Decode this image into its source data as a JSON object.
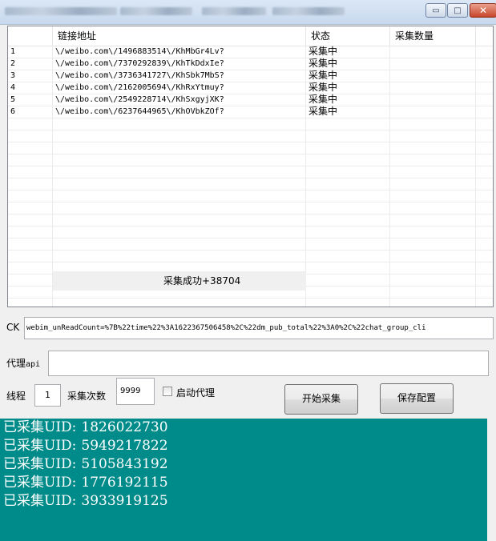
{
  "window": {
    "minimize_glyph": "▭",
    "maximize_glyph": "□",
    "close_glyph": "✕"
  },
  "table": {
    "headers": [
      "链接地址",
      "状态",
      "采集数量"
    ],
    "rows": [
      {
        "index": "1",
        "url": "\\/weibo.com\\/1496883514\\/KhMbGr4Lv?",
        "status": "采集中",
        "count": ""
      },
      {
        "index": "2",
        "url": "\\/weibo.com\\/7370292839\\/KhTkDdxIe?",
        "status": "采集中",
        "count": ""
      },
      {
        "index": "3",
        "url": "\\/weibo.com\\/3736341727\\/KhSbk7MbS?",
        "status": "采集中",
        "count": ""
      },
      {
        "index": "4",
        "url": "\\/weibo.com\\/2162005694\\/KhRxYtmuy?",
        "status": "采集中",
        "count": ""
      },
      {
        "index": "5",
        "url": "\\/weibo.com\\/2549228714\\/KhSxgyjXK?",
        "status": "采集中",
        "count": ""
      },
      {
        "index": "6",
        "url": "\\/weibo.com\\/6237644965\\/KhOVbkZOf?",
        "status": "采集中",
        "count": ""
      }
    ],
    "summary": "采集成功+38704"
  },
  "form": {
    "ck_label": "CK",
    "ck_value": "webim_unReadCount=%7B%22time%22%3A1622367506458%2C%22dm_pub_total%22%3A0%2C%22chat_group_cli",
    "proxy_label_cn": "代理",
    "proxy_label_en": "api",
    "proxy_value": "",
    "thread_label": "线程",
    "thread_value": "1",
    "count_label": "采集次数",
    "count_value": "9999",
    "enable_proxy_label": "启动代理",
    "enable_proxy_checked": false,
    "start_button": "开始采集",
    "save_button": "保存配置"
  },
  "console": {
    "prefix": "已采集UID:",
    "lines": [
      "1826022730",
      "5949217822",
      "5105843192",
      "1776192115",
      "3933919125"
    ]
  },
  "colors": {
    "console_bg": "#008b8b",
    "console_text": "#ffffff",
    "window_bg": "#f0f0f0"
  }
}
